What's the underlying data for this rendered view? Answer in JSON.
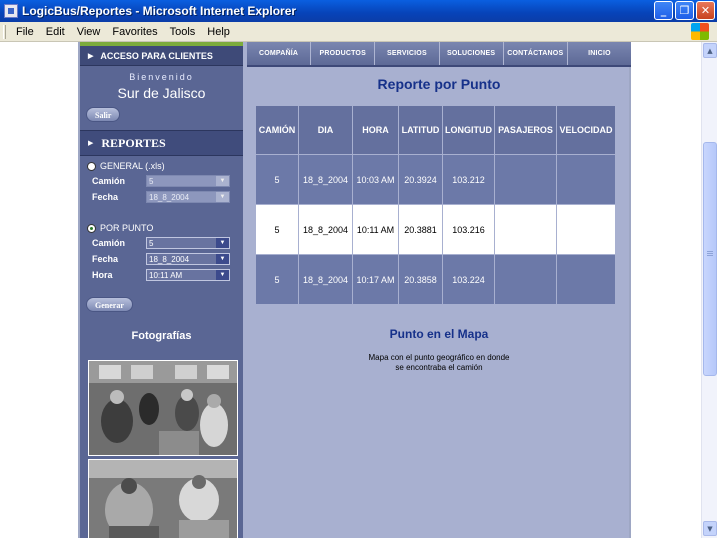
{
  "window": {
    "title": "LogicBus/Reportes - Microsoft Internet Explorer"
  },
  "menu": [
    "File",
    "Edit",
    "View",
    "Favorites",
    "Tools",
    "Help"
  ],
  "sidebar": {
    "access_header": "ACCESO PARA CLIENTES",
    "welcome": "Bienvenido",
    "company": "Sur de Jalisco",
    "logout_label": "Salir",
    "reports_header": "REPORTES",
    "general": {
      "label": "GENERAL (.xls)",
      "camion_label": "Camión",
      "camion_value": "5",
      "fecha_label": "Fecha",
      "fecha_value": "18_8_2004"
    },
    "por_punto": {
      "label": "POR PUNTO",
      "camion_label": "Camión",
      "camion_value": "5",
      "fecha_label": "Fecha",
      "fecha_value": "18_8_2004",
      "hora_label": "Hora",
      "hora_value": "10:11 AM"
    },
    "generate_label": "Generar",
    "photos_title": "Fotografías"
  },
  "nav": [
    "COMPAÑÍA",
    "PRODUCTOS",
    "SERVICIOS",
    "SOLUCIONES",
    "CONTÁCTANOS",
    "INICIO"
  ],
  "report": {
    "title": "Reporte por Punto",
    "columns": [
      "CAMIÓN",
      "DIA",
      "HORA",
      "LATITUD",
      "LONGITUD",
      "PASAJEROS",
      "VELOCIDAD"
    ],
    "rows": [
      [
        "5",
        "18_8_2004",
        "10:03 AM",
        "20.3924",
        "103.212",
        "",
        ""
      ],
      [
        "5",
        "18_8_2004",
        "10:11 AM",
        "20.3881",
        "103.216",
        "",
        ""
      ],
      [
        "5",
        "18_8_2004",
        "10:17 AM",
        "20.3858",
        "103.224",
        "",
        ""
      ]
    ]
  },
  "map": {
    "title": "Punto en el Mapa",
    "desc_line1": "Mapa con el punto geográfico en donde",
    "desc_line2": "se encontraba el camión"
  },
  "colors": {
    "nav_bg": "#5d6996",
    "sidebar_bg": "#5a6694",
    "page_bg": "#a8b0d0",
    "title_blue": "#16318a"
  }
}
